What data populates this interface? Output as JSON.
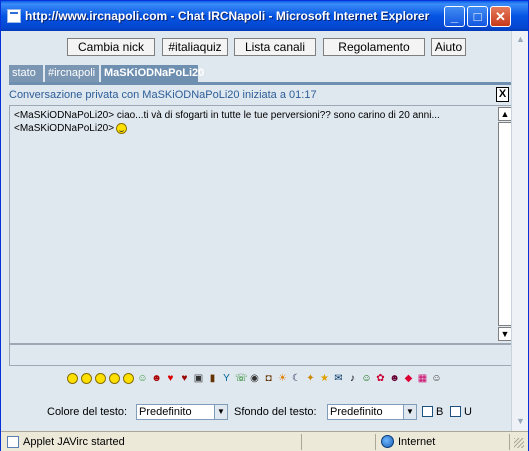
{
  "window": {
    "title": "http://www.ircnapoli.com - Chat IRCNapoli - Microsoft Internet Explorer",
    "controls": {
      "minimize": "_",
      "maximize": "□",
      "close": "✕"
    }
  },
  "toolbar": {
    "buttons": [
      "Cambia nick",
      "#italiaquiz",
      "Lista canali",
      "Regolamento",
      "Aiuto"
    ]
  },
  "tabs": [
    {
      "label": "stato",
      "active": false
    },
    {
      "label": "#ircnapoli",
      "active": false
    },
    {
      "label": "MaSKiODNaPoLi20",
      "active": true
    }
  ],
  "conversation": {
    "header": "Conversazione privata con MaSKiODNaPoLi20 iniziata a 01:17",
    "close_label": "X",
    "messages": [
      {
        "nick": "<MaSKiODNaPoLi20>",
        "text": " ciao...ti và di sfogarti in tutte le tue perversioni?? sono carino di 20 anni..."
      },
      {
        "nick": "<MaSKiODNaPoLi20>",
        "text": "",
        "emoticon": "smiley"
      }
    ]
  },
  "emoticons": [
    "smile-icon",
    "wink-icon",
    "grin-icon",
    "sad-icon",
    "cool-icon",
    "alien-icon",
    "devil-icon",
    "heart-icon",
    "broken-heart-icon",
    "camera-icon",
    "bottle-icon",
    "cocktail-icon",
    "phone-icon",
    "cat-icon",
    "mug-icon",
    "sun-icon",
    "moon-icon",
    "star-face-icon",
    "star-icon",
    "mail-icon",
    "music-icon",
    "person-icon",
    "flower-icon",
    "dancer-icon",
    "lips-icon",
    "gift-icon",
    "man-icon"
  ],
  "format": {
    "text_color_label": "Colore del testo:",
    "text_color_value": "Predefinito",
    "bg_color_label": "Sfondo del testo:",
    "bg_color_value": "Predefinito",
    "bold_label": "B",
    "underline_label": "U"
  },
  "statusbar": {
    "text": "Applet JAVirc started",
    "zone": "Internet"
  },
  "colors": {
    "titlebar": "#0554e4",
    "tab": "#7a96b3",
    "header_text": "#2c5d98",
    "background": "#dfe7ef"
  }
}
